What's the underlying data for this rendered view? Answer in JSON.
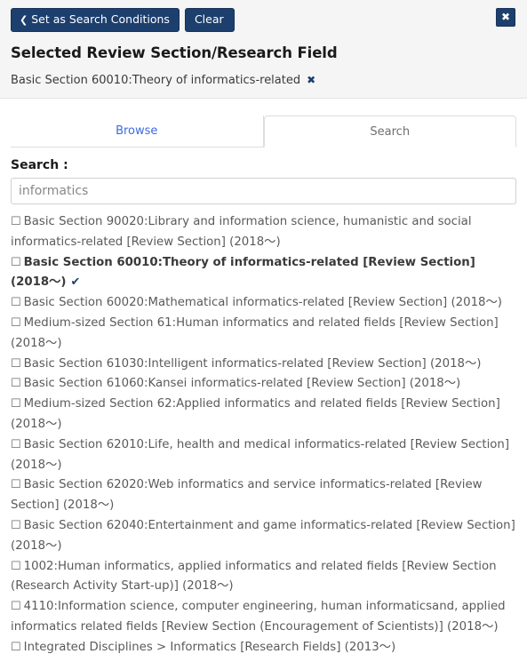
{
  "header": {
    "set_conditions_label": "Set as Search Conditions",
    "clear_label": "Clear",
    "chevron": "❮",
    "close_glyph": "✖",
    "title": "Selected Review Section/Research Field",
    "selected_field": "Basic Section 60010:Theory of informatics-related",
    "remove_glyph": "✖"
  },
  "tabs": [
    {
      "label": "Browse",
      "active": false
    },
    {
      "label": "Search",
      "active": true
    }
  ],
  "search": {
    "label": "Search :",
    "value": "informatics",
    "placeholder": ""
  },
  "results": {
    "checkbox_glyph": "☐",
    "tick_glyph": "✔",
    "items": [
      {
        "label": "Basic Section 90020:Library and information science, humanistic and social informatics-related [Review Section] (2018〜)",
        "selected": false
      },
      {
        "label": "Basic Section 60010:Theory of informatics-related [Review Section] (2018〜)",
        "selected": true
      },
      {
        "label": "Basic Section 60020:Mathematical informatics-related [Review Section] (2018〜)",
        "selected": false
      },
      {
        "label": "Medium-sized Section 61:Human informatics and related fields [Review Section] (2018〜)",
        "selected": false
      },
      {
        "label": "Basic Section 61030:Intelligent informatics-related [Review Section] (2018〜)",
        "selected": false
      },
      {
        "label": "Basic Section 61060:Kansei informatics-related [Review Section] (2018〜)",
        "selected": false
      },
      {
        "label": "Medium-sized Section 62:Applied informatics and related fields [Review Section] (2018〜)",
        "selected": false
      },
      {
        "label": "Basic Section 62010:Life, health and medical informatics-related [Review Section] (2018〜)",
        "selected": false
      },
      {
        "label": "Basic Section 62020:Web informatics and service informatics-related [Review Section] (2018〜)",
        "selected": false
      },
      {
        "label": "Basic Section 62040:Entertainment and game informatics-related [Review Section] (2018〜)",
        "selected": false
      },
      {
        "label": "1002:Human informatics, applied informatics and related fields [Review Section (Research Activity Start-up)] (2018〜)",
        "selected": false
      },
      {
        "label": "4110:Information science, computer engineering, human informaticsand, applied informatics related fields [Review Section (Encouragement of Scientists)] (2018〜)",
        "selected": false
      },
      {
        "label": "Integrated Disciplines > Informatics [Research Fields] (2013〜)",
        "selected": false
      }
    ]
  },
  "colors": {
    "brand_navy": "#1d3f6e",
    "link_blue": "#3d6ce0",
    "header_bg": "#f5f5f5"
  }
}
